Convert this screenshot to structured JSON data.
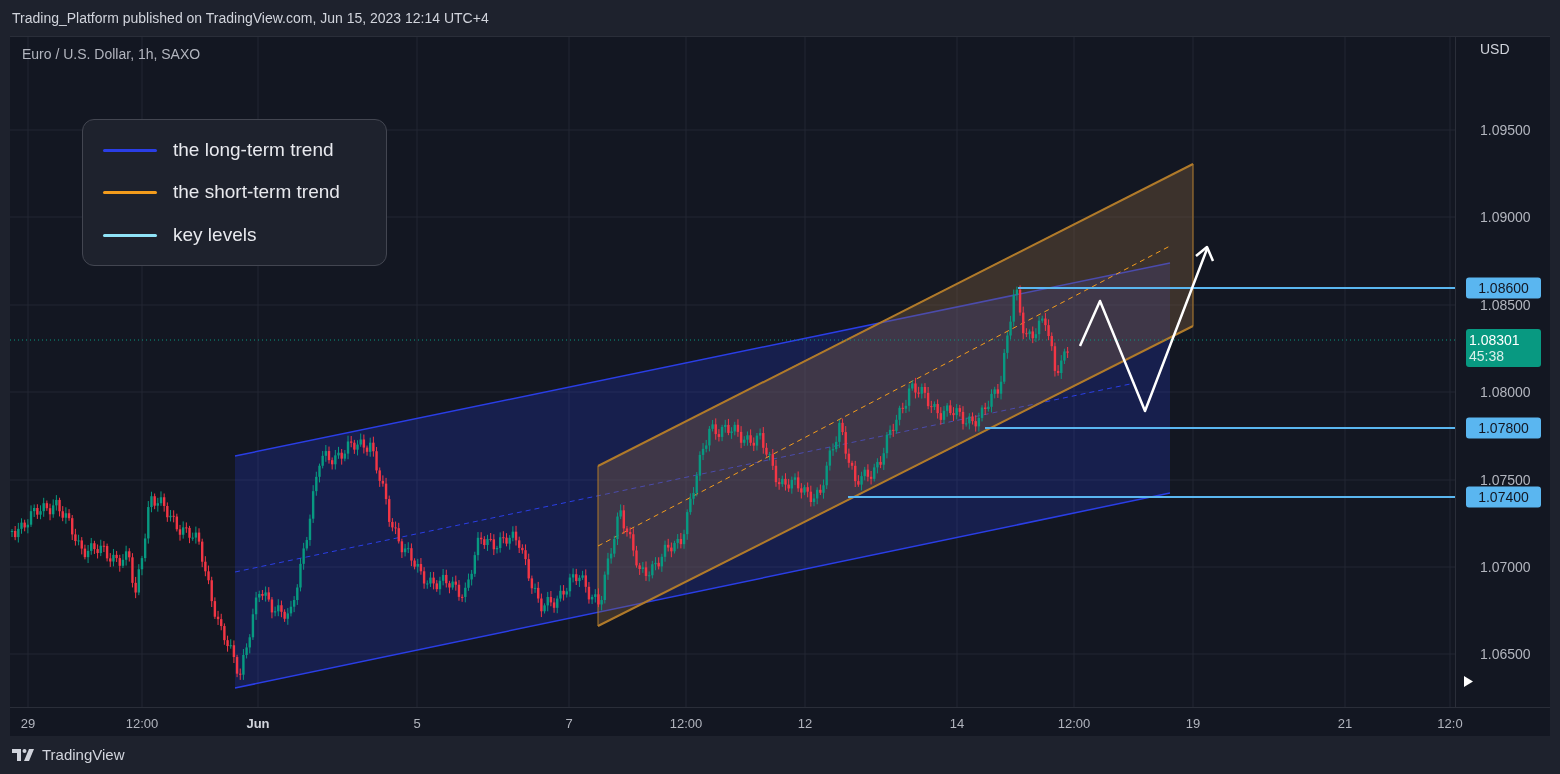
{
  "header": {
    "text": "Trading_Platform published on TradingView.com, Jun 15, 2023 12:14 UTC+4"
  },
  "chart": {
    "symbol": "Euro / U.S. Dollar, 1h, SAXO",
    "currency": "USD",
    "legend": [
      {
        "label": "the long-term trend",
        "color": "#2a3ee6"
      },
      {
        "label": "the short-term trend",
        "color": "#f39c1c"
      },
      {
        "label": "key levels",
        "color": "#8fe3f7"
      }
    ],
    "price_ticks": [
      "1.09500",
      "1.09000",
      "1.08500",
      "1.08000",
      "1.07500",
      "1.07000",
      "1.06500"
    ],
    "level_labels": [
      "1.08600",
      "1.07800",
      "1.07400"
    ],
    "last_price": {
      "price": "1.08301",
      "countdown": "45:38"
    },
    "time_ticks": [
      {
        "label": "29",
        "bold": false
      },
      {
        "label": "12:00",
        "bold": false
      },
      {
        "label": "Jun",
        "bold": true
      },
      {
        "label": "5",
        "bold": false
      },
      {
        "label": "7",
        "bold": false
      },
      {
        "label": "12:00",
        "bold": false
      },
      {
        "label": "12",
        "bold": false
      },
      {
        "label": "14",
        "bold": false
      },
      {
        "label": "12:00",
        "bold": false
      },
      {
        "label": "19",
        "bold": false
      },
      {
        "label": "21",
        "bold": false
      },
      {
        "label": "12:0",
        "bold": false
      }
    ]
  },
  "footer": {
    "brand": "TradingView"
  }
}
